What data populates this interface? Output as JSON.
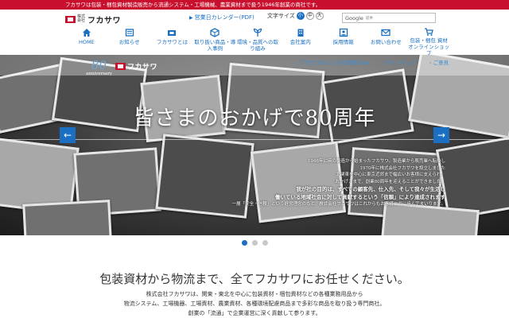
{
  "topbar": {
    "text": "フカサワは包装・梱包資材製造販売から流通システム・工場機械、農業資材まで扱う1946年創業の商社です。"
  },
  "header": {
    "logo": {
      "small": "株式会社",
      "name": "フカサワ"
    },
    "calendar_link": "営業日カレンダー(PDF)",
    "fontsize": {
      "label": "文字サイズ",
      "options": [
        "小",
        "中",
        "大"
      ]
    },
    "search": {
      "brand": "Google",
      "sub": "提供"
    }
  },
  "nav": {
    "items": [
      {
        "label": "HOME",
        "icon": "home-icon"
      },
      {
        "label": "お知らせ",
        "icon": "news-icon"
      },
      {
        "label": "フカサワとは",
        "icon": "company-icon"
      },
      {
        "label": "取り扱い商品・導入事例",
        "icon": "product-icon"
      },
      {
        "label": "環境・品質への取り組み",
        "icon": "leaf-icon"
      },
      {
        "label": "会社案内",
        "icon": "building-icon"
      },
      {
        "label": "採用情報",
        "icon": "recruit-icon"
      },
      {
        "label": "お問い合わせ",
        "icon": "mail-icon"
      },
      {
        "label": "包装・梱包 資材オンラインショップ",
        "icon": "cart-icon"
      }
    ]
  },
  "hero": {
    "anniversary_number": "80",
    "anniversary_text": "anniversary",
    "sub_logo": "フカサワ",
    "sub_links": [
      "フカサワのよくある質問Q＆A",
      "サイトマップ",
      "ご意見"
    ],
    "title": "皆さまのおかげで80周年",
    "body_lines": [
      "1946年に麻の製造から始まったフカサワ。製造業から販売業へ転換し",
      "1970年に株式会社フカサワを設立しました",
      "北関東を中心に東京近郊まで幅広いお客様に支えられ、",
      "おかげさまで、創業80周年を迎えることができました。"
    ],
    "body_em_lines": [
      "我が社の目的は、すべての顧客先、仕入先、そして我々が生活し",
      "働いている地域社会に対して貢献するという「信頼」により達成されます"
    ],
    "body_tail": "一層「安全・信頼」という経営理念のもと、株式会社フカサワはこれからもお客様と共に歩んでまいります。",
    "slides": 3,
    "active_slide": 0
  },
  "intro": {
    "heading": "包装資材から物流まで、全てフカサワにお任せください。",
    "body_lines": [
      "株式会社フカサワは、関東・東北を中心に包装資材・梱包資材などの各種業務用品から",
      "物流システム、工場機器、工場資材、農業資材、各種環境配慮商品まで多彩な商品を取り扱う専門商社。",
      "創業の「流通」で企業運営に深く貢献して参ります。"
    ]
  },
  "colors": {
    "brand_red": "#c8102e",
    "link_blue": "#1a6fc2"
  }
}
